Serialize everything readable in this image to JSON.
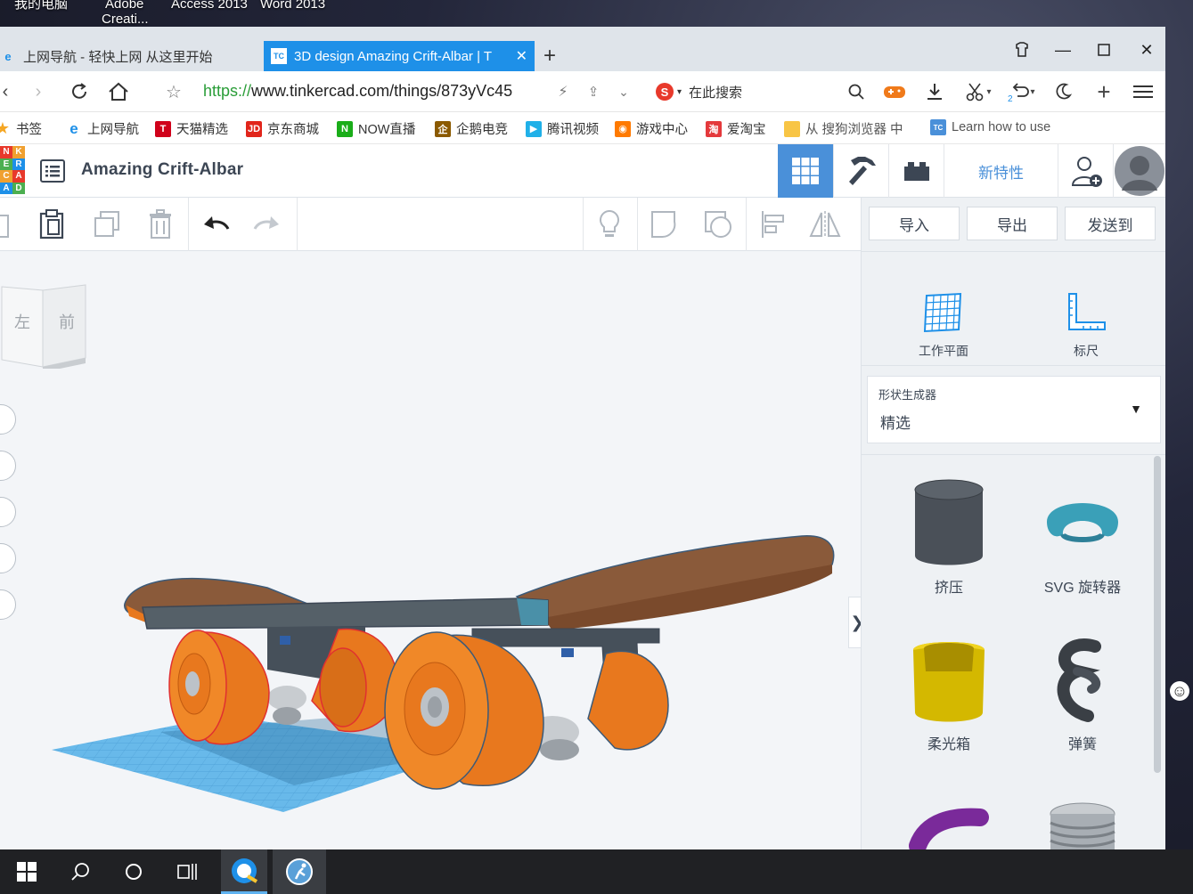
{
  "desktop": {
    "icons": [
      "我的电脑",
      "Adobe",
      "Creati...",
      "Access 2013",
      "Word 2013"
    ]
  },
  "browser": {
    "tabs": [
      {
        "label": "上网导航 - 轻快上网 从这里开始",
        "active": false
      },
      {
        "label": "3D design Amazing Crift-Albar | T",
        "active": true
      }
    ],
    "new_tab": "+",
    "url_scheme": "https://",
    "url_rest": "www.tinkercad.com/things/873yVc45",
    "search_placeholder": "在此搜索",
    "undo_count": "2",
    "bookmarks": [
      {
        "label": "书签",
        "color": "#f5a623"
      },
      {
        "label": "上网导航",
        "color": "#1e90e8"
      },
      {
        "label": "天猫精选",
        "color": "#d0021b"
      },
      {
        "label": "京东商城",
        "color": "#e1251b"
      },
      {
        "label": "NOW直播",
        "color": "#1aad19"
      },
      {
        "label": "企鹅电竞",
        "color": "#8b5a00"
      },
      {
        "label": "腾讯视频",
        "color": "#20b0e8"
      },
      {
        "label": "游戏中心",
        "color": "#ff7a00"
      },
      {
        "label": "爱淘宝",
        "color": "#e4393c"
      },
      {
        "label": "从 搜狗浏览器 中",
        "color": "#f8c545"
      },
      {
        "label": "Learn how to use",
        "color": "#4a90d9"
      }
    ]
  },
  "tinkercad": {
    "logo_letters": [
      "T",
      "I",
      "N",
      "K",
      "E",
      "R",
      "C",
      "A",
      "D"
    ],
    "design_title": "Amazing Crift-Albar",
    "new_features": "新特性",
    "actions": {
      "import": "导入",
      "export": "导出",
      "send_to": "发送到"
    },
    "viewcube": {
      "left": "左",
      "front": "前"
    },
    "tools": {
      "workplane": "工作平面",
      "ruler": "标尺"
    },
    "shape_generator": {
      "label": "形状生成器",
      "selected": "精选"
    },
    "shapes": [
      "挤压",
      "SVG 旋转器",
      "柔光箱",
      "弹簧"
    ],
    "collapse_arrow": "❯",
    "colors": {
      "accent": "#1e90e8",
      "active_view": "#4a90d9",
      "wheel": "#e8781e",
      "deck": "#8a5a3a",
      "truck": "#556068"
    }
  }
}
